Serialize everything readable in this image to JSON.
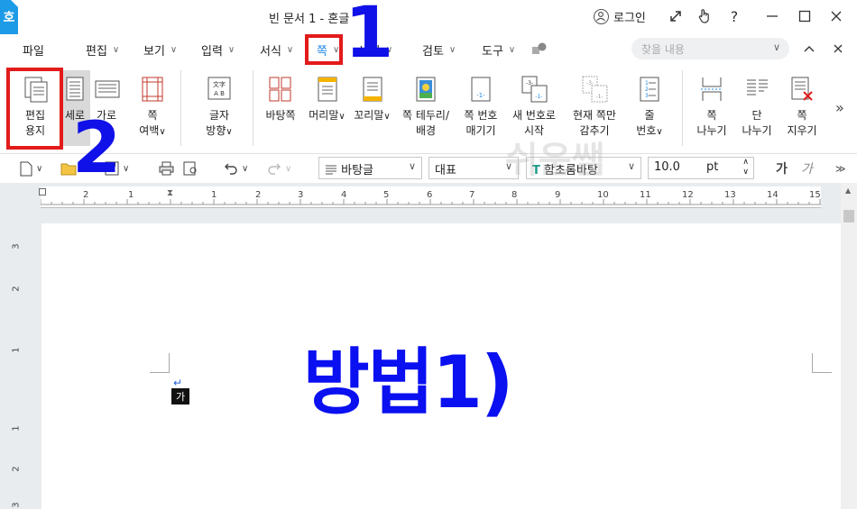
{
  "window": {
    "app_icon": "호",
    "title": "빈 문서 1 - 혼글",
    "login_label": "로그인",
    "help_label": "?"
  },
  "menu": {
    "items": [
      {
        "label": "파일",
        "has_chevron": false
      },
      {
        "label": "편집",
        "has_chevron": true
      },
      {
        "label": "보기",
        "has_chevron": true
      },
      {
        "label": "입력",
        "has_chevron": true
      },
      {
        "label": "서식",
        "has_chevron": true
      },
      {
        "label": "쪽",
        "has_chevron": true,
        "active": true
      },
      {
        "label": "보안",
        "has_chevron": true
      },
      {
        "label": "검토",
        "has_chevron": true
      },
      {
        "label": "도구",
        "has_chevron": true
      }
    ],
    "search_placeholder": "찾을 내용"
  },
  "ribbon": {
    "buttons": [
      {
        "id": "edit-paper",
        "lines": [
          "편집",
          "용지"
        ]
      },
      {
        "id": "portrait",
        "lines": [
          "세로"
        ]
      },
      {
        "id": "landscape",
        "lines": [
          "가로"
        ]
      },
      {
        "id": "page-margin",
        "lines": [
          "쪽",
          "여백"
        ],
        "has_chevron": true
      },
      {
        "id": "text-direction",
        "lines": [
          "글자",
          "방향"
        ],
        "has_chevron": true,
        "icon_text": "文字 A B"
      },
      {
        "id": "master-page",
        "lines": [
          "바탕쪽"
        ]
      },
      {
        "id": "header",
        "lines": [
          "머리말"
        ],
        "has_chevron": true
      },
      {
        "id": "footer",
        "lines": [
          "꼬리말"
        ],
        "has_chevron": true
      },
      {
        "id": "page-border",
        "lines": [
          "쪽 테두리/",
          "배경"
        ]
      },
      {
        "id": "page-number",
        "lines": [
          "쪽 번호",
          "매기기"
        ],
        "icon_text": "-1-"
      },
      {
        "id": "new-number",
        "lines": [
          "새 번호로",
          "시작"
        ],
        "icon_text": "-3- -1-"
      },
      {
        "id": "hide-current",
        "lines": [
          "현재 쪽만",
          "감추기"
        ],
        "icon_text": "-3- -1-"
      },
      {
        "id": "line-number",
        "lines": [
          "줄",
          "번호"
        ],
        "has_chevron": true,
        "icon_text": "1 2 3"
      },
      {
        "id": "page-break",
        "lines": [
          "쪽",
          "나누기"
        ]
      },
      {
        "id": "column-break",
        "lines": [
          "단",
          "나누기"
        ]
      },
      {
        "id": "delete-page",
        "lines": [
          "쪽",
          "지우기"
        ]
      }
    ],
    "more_label": "»"
  },
  "toolbar": {
    "style_value": "바탕글",
    "font_lang_value": "대표",
    "font_value": "함초롬바탕",
    "size_value": "10.0",
    "size_unit": "pt",
    "char_glyph": "가",
    "italic_glyph": "가"
  },
  "ruler": {
    "numbers": [
      "2",
      "1",
      "1",
      "2",
      "3",
      "4",
      "5",
      "6",
      "7",
      "8",
      "9",
      "10",
      "11",
      "12",
      "13",
      "14",
      "15"
    ]
  },
  "vruler": {
    "numbers": [
      "3",
      "2",
      "1",
      "1",
      "2",
      "3"
    ]
  },
  "document": {
    "cursor_char": "가",
    "body_text": "방법1)"
  },
  "watermark": "쉬운쌤",
  "annotations": {
    "step1": "1",
    "step2": "2",
    "color_box": "#e21b1b",
    "color_num": "#1010e8"
  },
  "colors": {
    "accent": "#1e9be6",
    "active_menu": "#1e88e5",
    "body_text": "#0a10f0"
  }
}
